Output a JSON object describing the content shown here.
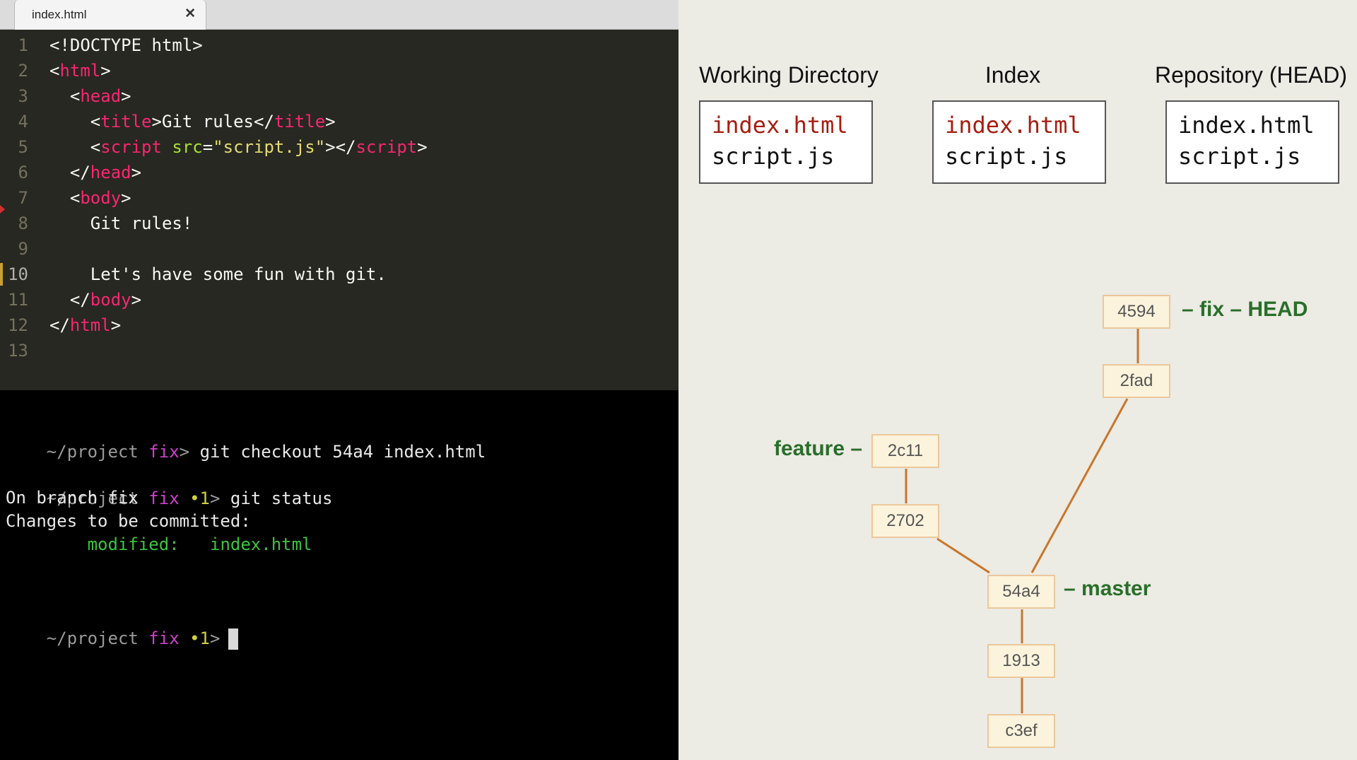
{
  "editor": {
    "tab_label": "index.html",
    "tab_close": "✕",
    "lines": [
      {
        "n": "1",
        "parts": [
          {
            "t": "<!DOCTYPE html>",
            "c": "punc"
          }
        ]
      },
      {
        "n": "2",
        "parts": [
          {
            "t": "<",
            "c": "punc"
          },
          {
            "t": "html",
            "c": "tag"
          },
          {
            "t": ">",
            "c": "punc"
          }
        ]
      },
      {
        "n": "3",
        "parts": [
          {
            "t": "  <",
            "c": "punc"
          },
          {
            "t": "head",
            "c": "tag"
          },
          {
            "t": ">",
            "c": "punc"
          }
        ]
      },
      {
        "n": "4",
        "parts": [
          {
            "t": "    <",
            "c": "punc"
          },
          {
            "t": "title",
            "c": "tag"
          },
          {
            "t": ">Git rules</",
            "c": "punc"
          },
          {
            "t": "title",
            "c": "tag"
          },
          {
            "t": ">",
            "c": "punc"
          }
        ]
      },
      {
        "n": "5",
        "parts": [
          {
            "t": "    <",
            "c": "punc"
          },
          {
            "t": "script",
            "c": "tag"
          },
          {
            "t": " ",
            "c": "punc"
          },
          {
            "t": "src",
            "c": "attr"
          },
          {
            "t": "=",
            "c": "punc"
          },
          {
            "t": "\"script.js\"",
            "c": "str"
          },
          {
            "t": "></",
            "c": "punc"
          },
          {
            "t": "script",
            "c": "tag"
          },
          {
            "t": ">",
            "c": "punc"
          }
        ]
      },
      {
        "n": "6",
        "parts": [
          {
            "t": "  </",
            "c": "punc"
          },
          {
            "t": "head",
            "c": "tag"
          },
          {
            "t": ">",
            "c": "punc"
          }
        ]
      },
      {
        "n": "7",
        "parts": [
          {
            "t": "  <",
            "c": "punc"
          },
          {
            "t": "body",
            "c": "tag"
          },
          {
            "t": ">",
            "c": "punc"
          }
        ]
      },
      {
        "n": "8",
        "parts": [
          {
            "t": "    Git rules!",
            "c": "punc"
          }
        ]
      },
      {
        "n": "9",
        "parts": []
      },
      {
        "n": "10",
        "parts": [
          {
            "t": "    Let's have some fun with git.",
            "c": "punc"
          }
        ]
      },
      {
        "n": "11",
        "parts": [
          {
            "t": "  </",
            "c": "punc"
          },
          {
            "t": "body",
            "c": "tag"
          },
          {
            "t": ">",
            "c": "punc"
          }
        ]
      },
      {
        "n": "12",
        "parts": [
          {
            "t": "</",
            "c": "punc"
          },
          {
            "t": "html",
            "c": "tag"
          },
          {
            "t": ">",
            "c": "punc"
          }
        ]
      },
      {
        "n": "13",
        "parts": []
      }
    ]
  },
  "terminal": {
    "prompt_path": "~/project",
    "prompt_branch": "fix",
    "prompt_dot": "•1",
    "prompt_symbol": ">",
    "cmd1": "git checkout 54a4 index.html",
    "cmd2": "git status",
    "out1": "On branch fix",
    "out2": "Changes to be committed:",
    "out3_label": "modified:",
    "out3_file": "index.html"
  },
  "areas": {
    "working": {
      "title": "Working Directory",
      "file1": "index.html",
      "file2": "script.js"
    },
    "index": {
      "title": "Index",
      "file1": "index.html",
      "file2": "script.js"
    },
    "repo": {
      "title": "Repository (HEAD)",
      "file1": "index.html",
      "file2": "script.js"
    }
  },
  "colors": {
    "modified_file": "#a61d10",
    "clean_file": "#111111",
    "edge": "#c9762c"
  },
  "graph": {
    "commits": {
      "c4594": "4594",
      "c2fad": "2fad",
      "c2c11": "2c11",
      "c2702": "2702",
      "c54a4": "54a4",
      "c1913": "1913",
      "c3ef": "c3ef"
    },
    "refs": {
      "fix_head": "– fix – HEAD",
      "feature": "feature –",
      "master": "– master"
    }
  }
}
